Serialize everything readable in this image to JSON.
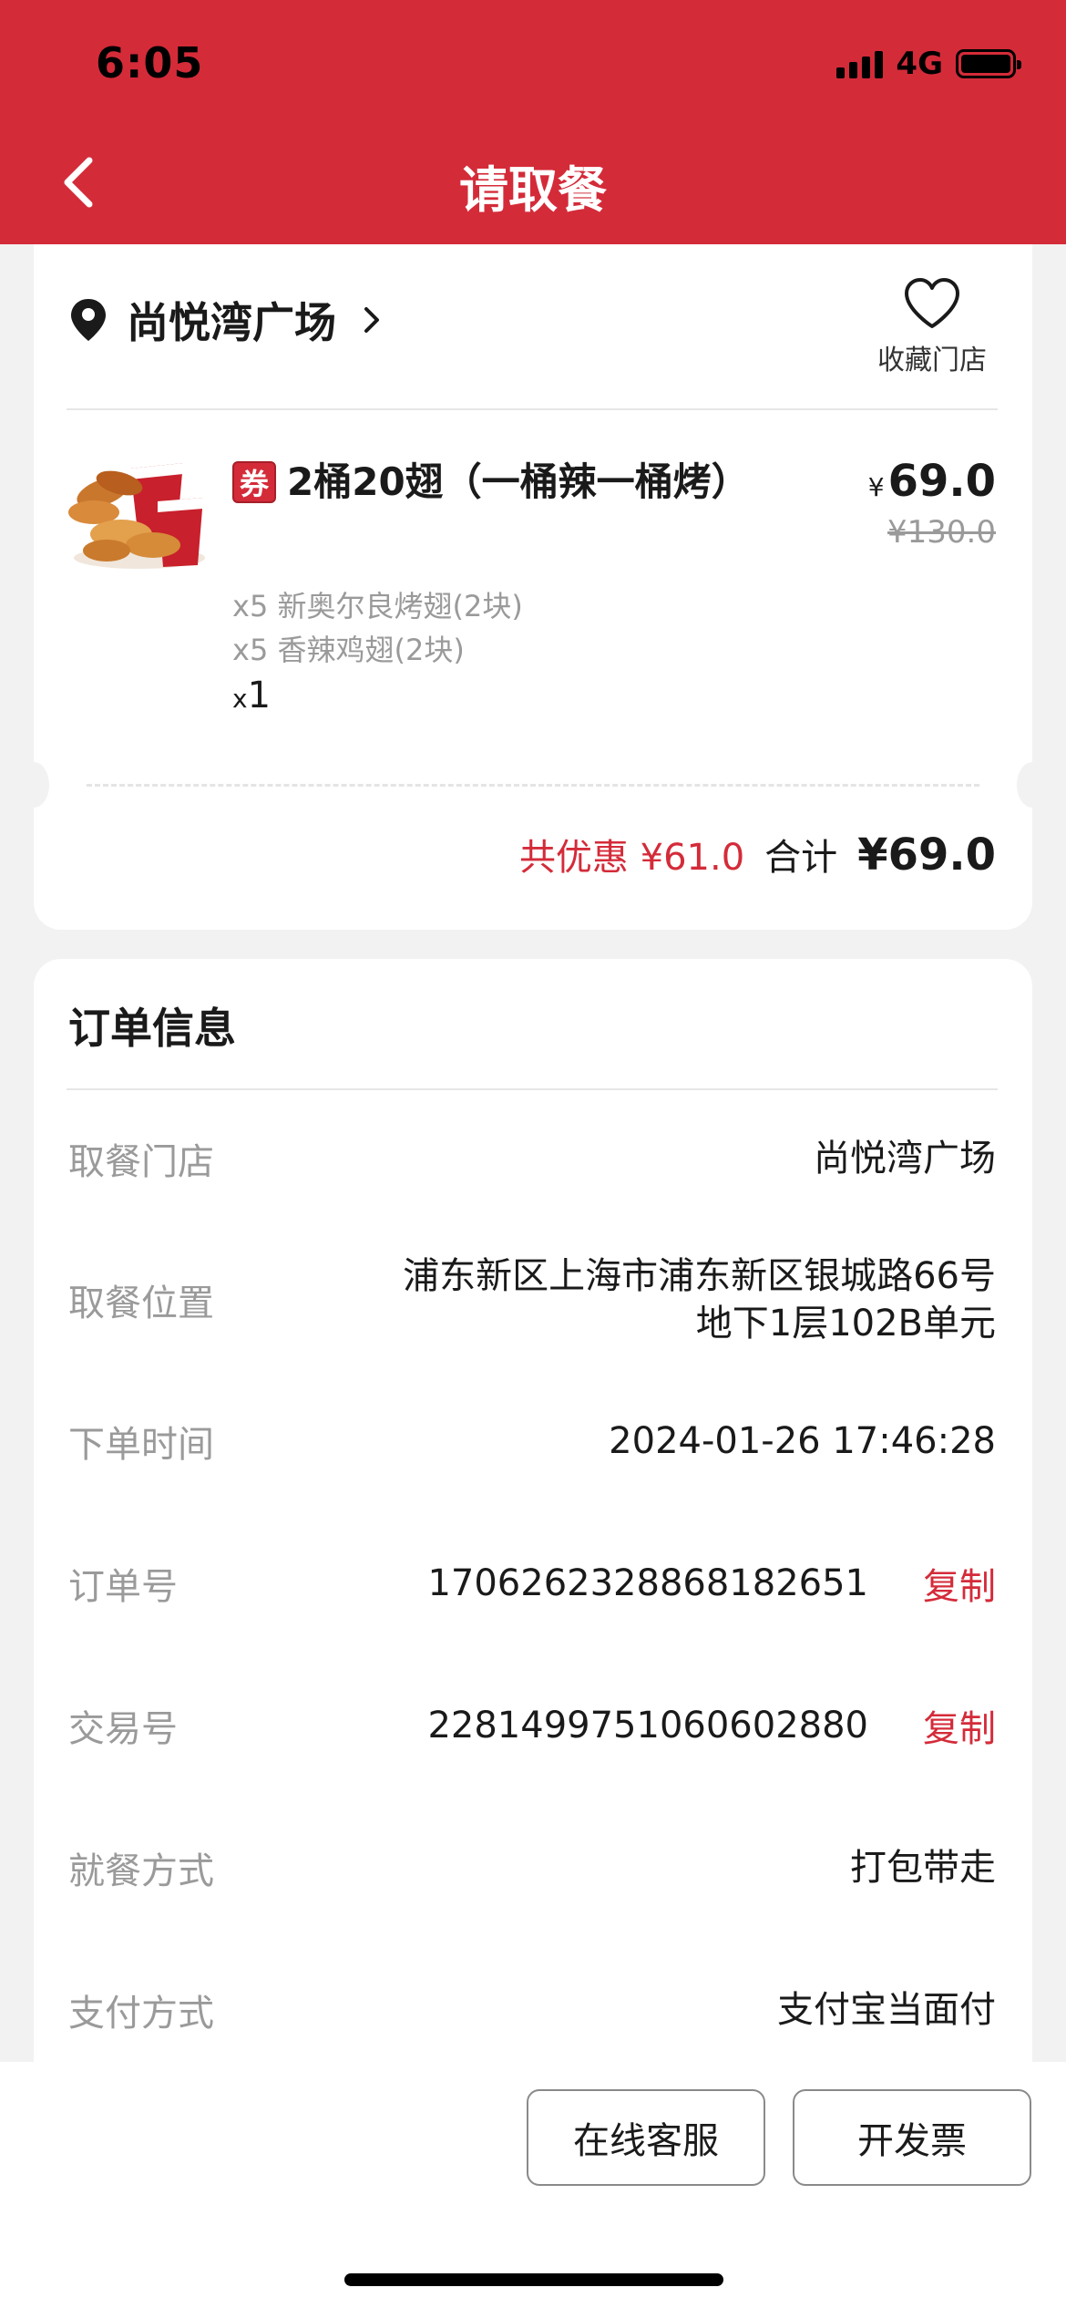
{
  "status_bar": {
    "time": "6:05",
    "network": "4G"
  },
  "nav": {
    "title": "请取餐"
  },
  "store": {
    "name": "尚悦湾广场",
    "favorite_label": "收藏门店"
  },
  "product": {
    "coupon_badge": "券",
    "name": "2桶20翅（一桶辣一桶烤）",
    "currency": "¥",
    "price": "69.0",
    "original_price": "¥130.0",
    "items": [
      "x5 新奥尔良烤翅(2块)",
      "x5 香辣鸡翅(2块)"
    ],
    "qty_prefix": "x",
    "qty": "1"
  },
  "totals": {
    "discount_text": "共优惠 ¥61.0",
    "total_label": "合计",
    "total_value": "¥69.0"
  },
  "order_info": {
    "title": "订单信息",
    "rows": [
      {
        "label": "取餐门店",
        "value": "尚悦湾广场"
      },
      {
        "label": "取餐位置",
        "value": "浦东新区上海市浦东新区银城路66号地下1层102B单元"
      },
      {
        "label": "下单时间",
        "value": "2024-01-26 17:46:28"
      },
      {
        "label": "订单号",
        "value": "1706262328868182651",
        "action": "复制"
      },
      {
        "label": "交易号",
        "value": "2281499751060602880",
        "action": "复制"
      },
      {
        "label": "就餐方式",
        "value": "打包带走"
      },
      {
        "label": "支付方式",
        "value": "支付宝当面付"
      }
    ]
  },
  "actions": {
    "service_label": "在线客服",
    "invoice_label": "开发票"
  },
  "colors": {
    "brand_red": "#d42b39",
    "muted_gray": "#9a9a9a"
  },
  "icons": [
    "back-chevron-icon",
    "location-pin-icon",
    "chevron-right-icon",
    "heart-icon",
    "coupon-icon",
    "signal-icon",
    "battery-icon"
  ]
}
